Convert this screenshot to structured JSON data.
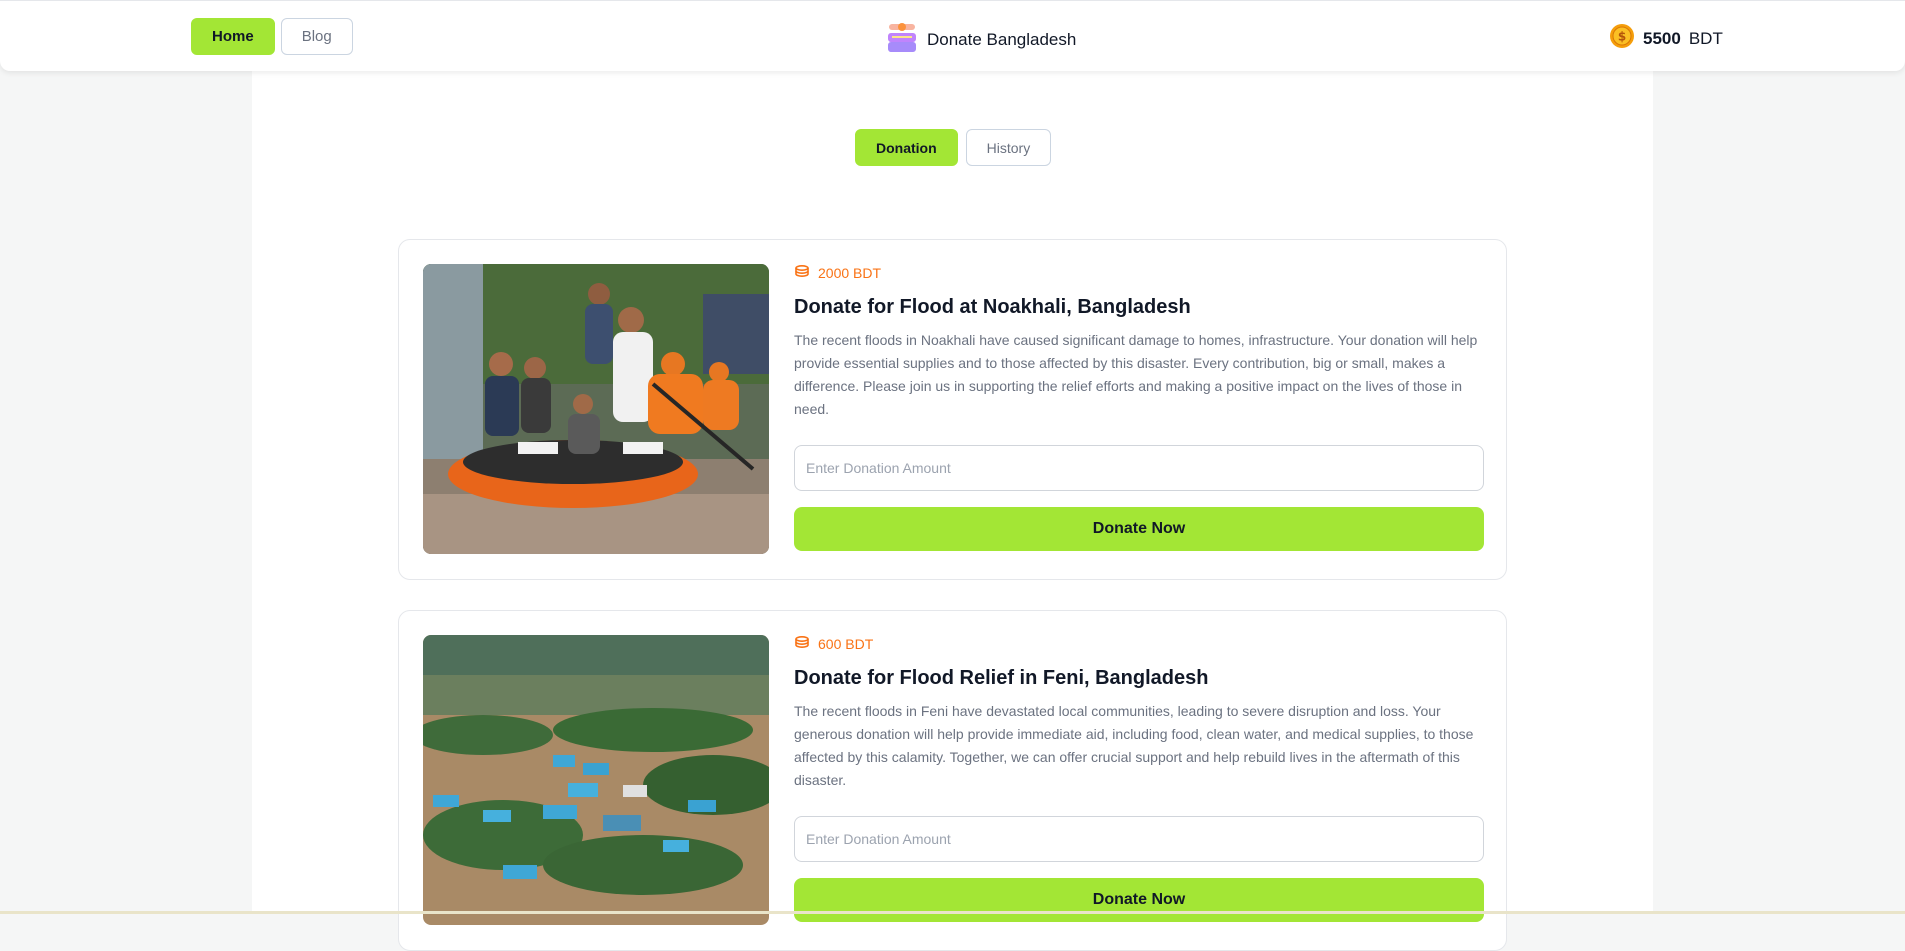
{
  "nav": {
    "home_label": "Home",
    "blog_label": "Blog",
    "brand_name": "Donate Bangladesh",
    "balance_amount": "5500",
    "balance_currency": "BDT"
  },
  "tabs": {
    "donation_label": "Donation",
    "history_label": "History"
  },
  "cards": [
    {
      "amount": "2000 BDT",
      "title": "Donate for Flood at Noakhali, Bangladesh",
      "description": "The recent floods in Noakhali have caused significant damage to homes, infrastructure. Your donation will help provide essential supplies and to those affected by this disaster. Every contribution, big or small, makes a difference. Please join us in supporting the relief efforts and making a positive impact on the lives of those in need.",
      "input_placeholder": "Enter Donation Amount",
      "button_label": "Donate Now"
    },
    {
      "amount": "600 BDT",
      "title": "Donate for Flood Relief in Feni, Bangladesh",
      "description": "The recent floods in Feni have devastated local communities, leading to severe disruption and loss. Your generous donation will help provide immediate aid, including food, clean water, and medical supplies, to those affected by this calamity. Together, we can offer crucial support and help rebuild lives in the aftermath of this disaster.",
      "input_placeholder": "Enter Donation Amount",
      "button_label": "Donate Now"
    }
  ],
  "colors": {
    "accent": "#a3e635",
    "amount": "#f97316"
  }
}
